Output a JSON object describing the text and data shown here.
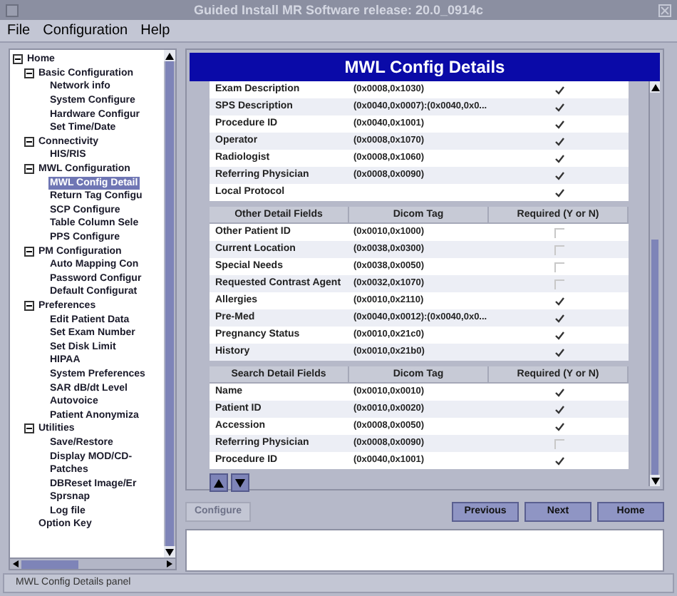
{
  "window": {
    "title": "Guided Install  MR Software release: 20.0_0914c"
  },
  "menu": [
    "File",
    "Configuration",
    "Help"
  ],
  "tree": [
    {
      "label": "Home",
      "expanded": true,
      "selected": false,
      "children": [
        {
          "label": "Basic Configuration",
          "expanded": true,
          "selected": false,
          "children": [
            {
              "label": "Network info",
              "selected": false
            },
            {
              "label": "System Configure",
              "selected": false
            },
            {
              "label": "Hardware Configur",
              "selected": false
            },
            {
              "label": "Set Time/Date",
              "selected": false
            }
          ]
        },
        {
          "label": "Connectivity",
          "expanded": true,
          "selected": false,
          "children": [
            {
              "label": "HIS/RIS",
              "selected": false
            }
          ]
        },
        {
          "label": "MWL Configuration",
          "expanded": true,
          "selected": false,
          "children": [
            {
              "label": "MWL Config Detail",
              "selected": true
            },
            {
              "label": "Return Tag Configu",
              "selected": false
            },
            {
              "label": "SCP Configure",
              "selected": false
            },
            {
              "label": "Table Column Sele",
              "selected": false
            },
            {
              "label": "PPS Configure",
              "selected": false
            }
          ]
        },
        {
          "label": "PM Configuration",
          "expanded": true,
          "selected": false,
          "children": [
            {
              "label": "Auto Mapping Con",
              "selected": false
            },
            {
              "label": "Password Configur",
              "selected": false
            },
            {
              "label": "Default Configurat",
              "selected": false
            }
          ]
        },
        {
          "label": "Preferences",
          "expanded": true,
          "selected": false,
          "children": [
            {
              "label": "Edit Patient Data",
              "selected": false
            },
            {
              "label": "Set Exam Number",
              "selected": false
            },
            {
              "label": "Set Disk Limit",
              "selected": false
            },
            {
              "label": "HIPAA",
              "selected": false
            },
            {
              "label": "System Preferences",
              "selected": false
            },
            {
              "label": "SAR dB/dt Level",
              "selected": false
            },
            {
              "label": "Autovoice",
              "selected": false
            },
            {
              "label": "Patient Anonymiza",
              "selected": false
            }
          ]
        },
        {
          "label": "Utilities",
          "expanded": true,
          "selected": false,
          "children": [
            {
              "label": "Save/Restore",
              "selected": false
            },
            {
              "label": "Display MOD/CD-",
              "selected": false
            },
            {
              "label": "Patches",
              "selected": false
            },
            {
              "label": "DBReset Image/Er",
              "selected": false
            },
            {
              "label": "Sprsnap",
              "selected": false
            },
            {
              "label": "Log file",
              "selected": false
            }
          ]
        },
        {
          "label": "Option Key",
          "selected": false
        }
      ]
    }
  ],
  "panel": {
    "title": "MWL Config Details"
  },
  "tables": [
    {
      "rows": [
        {
          "field": "Exam Description",
          "tag": "(0x0008,0x1030)",
          "required": true
        },
        {
          "field": "SPS Description",
          "tag": "(0x0040,0x0007):(0x0040,0x0...",
          "required": true
        },
        {
          "field": "Procedure ID",
          "tag": "(0x0040,0x1001)",
          "required": true
        },
        {
          "field": "Operator",
          "tag": "(0x0008,0x1070)",
          "required": true
        },
        {
          "field": "Radiologist",
          "tag": "(0x0008,0x1060)",
          "required": true
        },
        {
          "field": "Referring Physician",
          "tag": "(0x0008,0x0090)",
          "required": true
        },
        {
          "field": "Local Protocol",
          "required": true
        }
      ]
    },
    {
      "columns": [
        "Other Detail Fields",
        "Dicom Tag",
        "Required (Y or N)"
      ],
      "rows": [
        {
          "field": "Other Patient ID",
          "tag": "(0x0010,0x1000)",
          "required": false
        },
        {
          "field": "Current Location",
          "tag": "(0x0038,0x0300)",
          "required": false
        },
        {
          "field": "Special Needs",
          "tag": "(0x0038,0x0050)",
          "required": false
        },
        {
          "field": "Requested Contrast Agent",
          "tag": "(0x0032,0x1070)",
          "required": false
        },
        {
          "field": "Allergies",
          "tag": "(0x0010,0x2110)",
          "required": true
        },
        {
          "field": "Pre-Med",
          "tag": "(0x0040,0x0012):(0x0040,0x0...",
          "required": true
        },
        {
          "field": "Pregnancy Status",
          "tag": "(0x0010,0x21c0)",
          "required": true
        },
        {
          "field": "History",
          "tag": "(0x0010,0x21b0)",
          "required": true
        }
      ]
    },
    {
      "columns": [
        "Search Detail Fields",
        "Dicom Tag",
        "Required (Y or N)"
      ],
      "rows": [
        {
          "field": "Name",
          "tag": "(0x0010,0x0010)",
          "required": true
        },
        {
          "field": "Patient ID",
          "tag": "(0x0010,0x0020)",
          "required": true
        },
        {
          "field": "Accession",
          "tag": "(0x0008,0x0050)",
          "required": true
        },
        {
          "field": "Referring Physician",
          "tag": "(0x0008,0x0090)",
          "required": false
        },
        {
          "field": "Procedure ID",
          "tag": "(0x0040,0x1001)",
          "required": true
        }
      ]
    }
  ],
  "buttons": [
    {
      "label": "Configure",
      "disabled": true
    },
    {
      "label": "Previous",
      "disabled": false
    },
    {
      "label": "Next",
      "disabled": false
    },
    {
      "label": "Home",
      "disabled": false
    }
  ],
  "status_bar": "MWL Config Details panel"
}
